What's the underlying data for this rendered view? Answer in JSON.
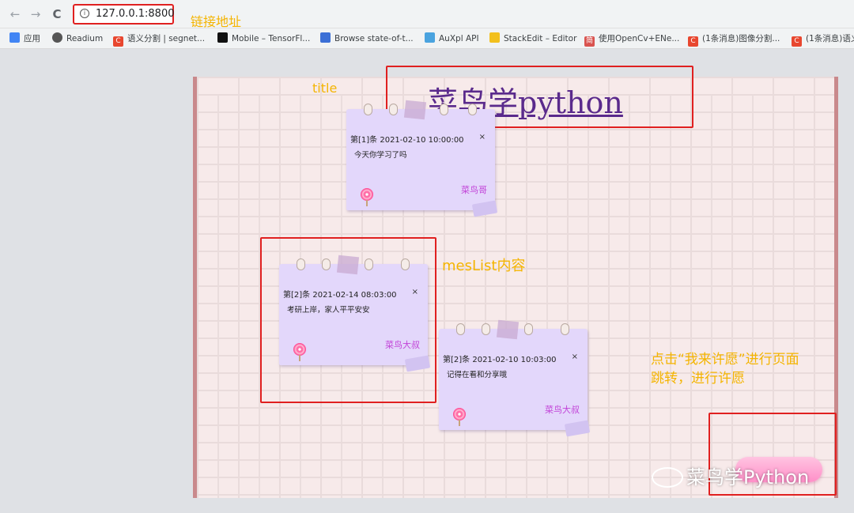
{
  "browser": {
    "url": "127.0.0.1:8800",
    "back_glyph": "←",
    "forward_glyph": "→",
    "reload_glyph": "C",
    "info_glyph": "i",
    "bookmarks": [
      {
        "label": "应用",
        "icon": "apps-icon",
        "color": "#4285f4"
      },
      {
        "label": "Readium",
        "icon": "readium-icon",
        "color": "#555555"
      },
      {
        "label": "语义分割 | segnet...",
        "icon": "csdn-icon",
        "color": "#e8472f"
      },
      {
        "label": "Mobile – TensorFl...",
        "icon": "medium-icon",
        "color": "#111111"
      },
      {
        "label": "Browse state-of-t...",
        "icon": "pwc-icon",
        "color": "#3b6fd6"
      },
      {
        "label": "AuXpl API",
        "icon": "api-icon",
        "color": "#4aa3df"
      },
      {
        "label": "StackEdit – Editor",
        "icon": "stackedit-icon",
        "color": "#f2c01e"
      },
      {
        "label": "使用OpenCv+ENe...",
        "icon": "jian-icon",
        "color": "#d9534f"
      },
      {
        "label": "(1条消息)图像分割...",
        "icon": "csdn-icon",
        "color": "#e8472f"
      },
      {
        "label": "(1条消息)语义",
        "icon": "csdn-icon",
        "color": "#e8472f"
      }
    ]
  },
  "annotations": {
    "link_address": "链接地址",
    "title": "title",
    "mes_list": "mesList内容",
    "click_hint_line1": "点击“我来许愿”进行页面",
    "click_hint_line2": "跳转，进行许愿"
  },
  "page": {
    "title": "菜鸟学python",
    "notes": [
      {
        "header": "第[1]条 2021-02-10 10:00:00",
        "content": "今天你学习了吗",
        "author": "菜鸟哥"
      },
      {
        "header": "第[2]条 2021-02-14 08:03:00",
        "content": "考研上岸，家人平平安安",
        "author": "菜鸟大叔"
      },
      {
        "header": "第[2]条 2021-02-10 10:03:00",
        "content": "记得在看和分享哦",
        "author": "菜鸟大叔"
      }
    ],
    "close_glyph": "×",
    "watermark": "菜鸟学Python"
  },
  "colors": {
    "highlight_box": "#e02020",
    "annotation": "#f4b400",
    "note_bg": "#e3d7fb",
    "author": "#c243d8"
  }
}
